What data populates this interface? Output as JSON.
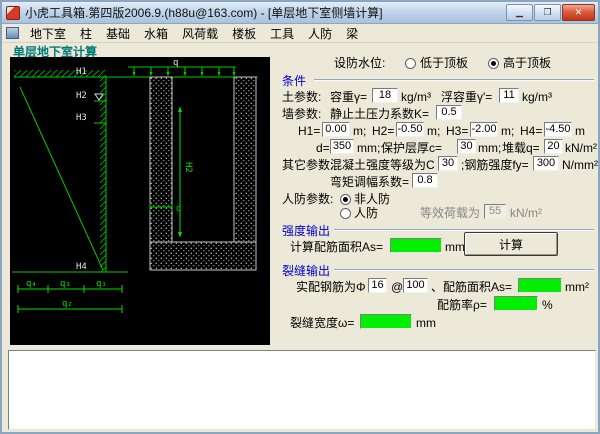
{
  "window": {
    "title": "小虎工具箱.第四版2006.9.(h88u@163.com) - [单层地下室侧墙计算]"
  },
  "menu": {
    "items": [
      "地下室",
      "柱",
      "基础",
      "水箱",
      "风荷载",
      "楼板",
      "工具",
      "人防",
      "梁"
    ]
  },
  "tab_label": "单层地下室计算",
  "water": {
    "label": "设防水位:",
    "opt_low": "低于顶板",
    "opt_high": "高于顶板"
  },
  "conditions": {
    "title": "条件",
    "soil_label": "土参数:",
    "gamma_label": "容重γ=",
    "gamma_value": "18",
    "gamma_unit": "kg/m³",
    "buoyant_label": "浮容重γ'=",
    "buoyant_value": "11",
    "buoyant_unit": "kg/m³",
    "wall_label": "墙参数:",
    "k_label": "静止土压力系数K=",
    "k_value": "0.5",
    "h1_label": "H1=",
    "h1_value": "0.00",
    "h1_unit": "m;",
    "h2_label": "H2=",
    "h2_value": "-0.50",
    "h2_unit": "m;",
    "h3_label": "H3=",
    "h3_value": "-2.00",
    "h3_unit": "m;",
    "h4_label": "H4=",
    "h4_value": "-4.50",
    "h4_unit": "m",
    "d_label": "d=",
    "d_value": "350",
    "d_unit": "mm;",
    "cover_label": "保护层厚c=",
    "cover_value": "30",
    "cover_unit": "mm;",
    "surcharge_label": "堆载q=",
    "surcharge_value": "20",
    "surcharge_unit": "kN/m²",
    "other_label": "其它参数:",
    "concrete_label": "混凝土强度等级为C",
    "concrete_value": "30",
    "steel_label": ";钢筋强度fy=",
    "steel_value": "300",
    "steel_unit": "N/mm²",
    "moment_label": "弯矩调幅系数=",
    "moment_value": "0.8",
    "renfang_label": "人防参数:",
    "opt_non_renfang": "非人防",
    "opt_renfang": "人防",
    "equiv_label": "等效荷载为",
    "equiv_value": "55",
    "equiv_unit": "kN/m²"
  },
  "strength": {
    "title": "强度输出",
    "as_label": "计算配筋面积As=",
    "as_value": "",
    "as_unit": "mm²",
    "calc_button": "计算"
  },
  "crack": {
    "title": "裂缝输出",
    "rebar_label": "实配钢筋为Φ",
    "rebar_dia": "16",
    "at_label": "@",
    "rebar_spacing": "100",
    "area_label": "、配筋面积As=",
    "area_value": "",
    "area_unit": "mm²",
    "ratio_label": "配筋率ρ=",
    "ratio_value": "",
    "ratio_unit": "%",
    "width_label": "裂缝宽度ω=",
    "width_value": "",
    "width_unit": "mm"
  },
  "drawing": {
    "labels": {
      "q": "q",
      "h1": "H1",
      "h2": "H2",
      "h3": "H3",
      "h4": "H4",
      "d": "d",
      "dim_v": "H2",
      "q1": "q₁",
      "q2": "q₂",
      "q3": "q₃",
      "q4": "q₄"
    }
  }
}
